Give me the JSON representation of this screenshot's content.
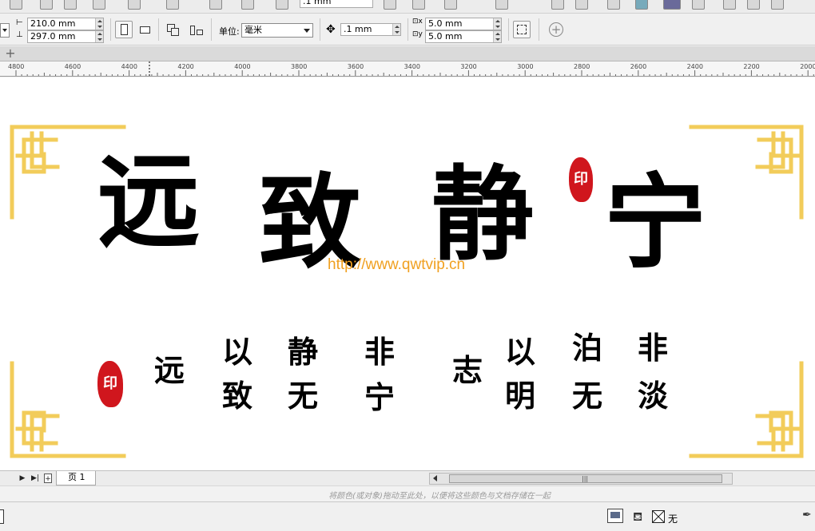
{
  "property_bar": {
    "page_width": "210.0 mm",
    "page_height": "297.0 mm",
    "unit_label": "单位:",
    "unit_value": "毫米",
    "nudge": ".1 mm",
    "dup_x": "5.0 mm",
    "dup_y": "5.0 mm",
    "top_nudge_partial": ".1 mm"
  },
  "ruler": {
    "labels": [
      "4800",
      "4600",
      "4400",
      "4200",
      "4000",
      "3800",
      "3600",
      "3400",
      "3200",
      "3000",
      "2800",
      "2600",
      "2400",
      "2200",
      "2000"
    ]
  },
  "artwork": {
    "main_chars": [
      "远",
      "致",
      "静",
      "宁"
    ],
    "verse_columns": [
      [
        "远"
      ],
      [
        "以",
        "致"
      ],
      [
        "静",
        "无"
      ],
      [
        "非",
        "宁"
      ],
      [
        "志"
      ],
      [
        "以",
        "明"
      ],
      [
        "泊",
        "无"
      ],
      [
        "非",
        "淡"
      ]
    ],
    "seal_text": "印",
    "watermark": "http://www.qwtvip.cn",
    "border_color": "#f2cc5a",
    "seal_color": "#d0161d"
  },
  "page_bar": {
    "page_tab": "页 1"
  },
  "color_bar": {
    "hint": "将颜色(或对象)拖动至此处，以便将这些颜色与文档存储在一起"
  },
  "status_bar": {
    "fill_none": "无"
  }
}
